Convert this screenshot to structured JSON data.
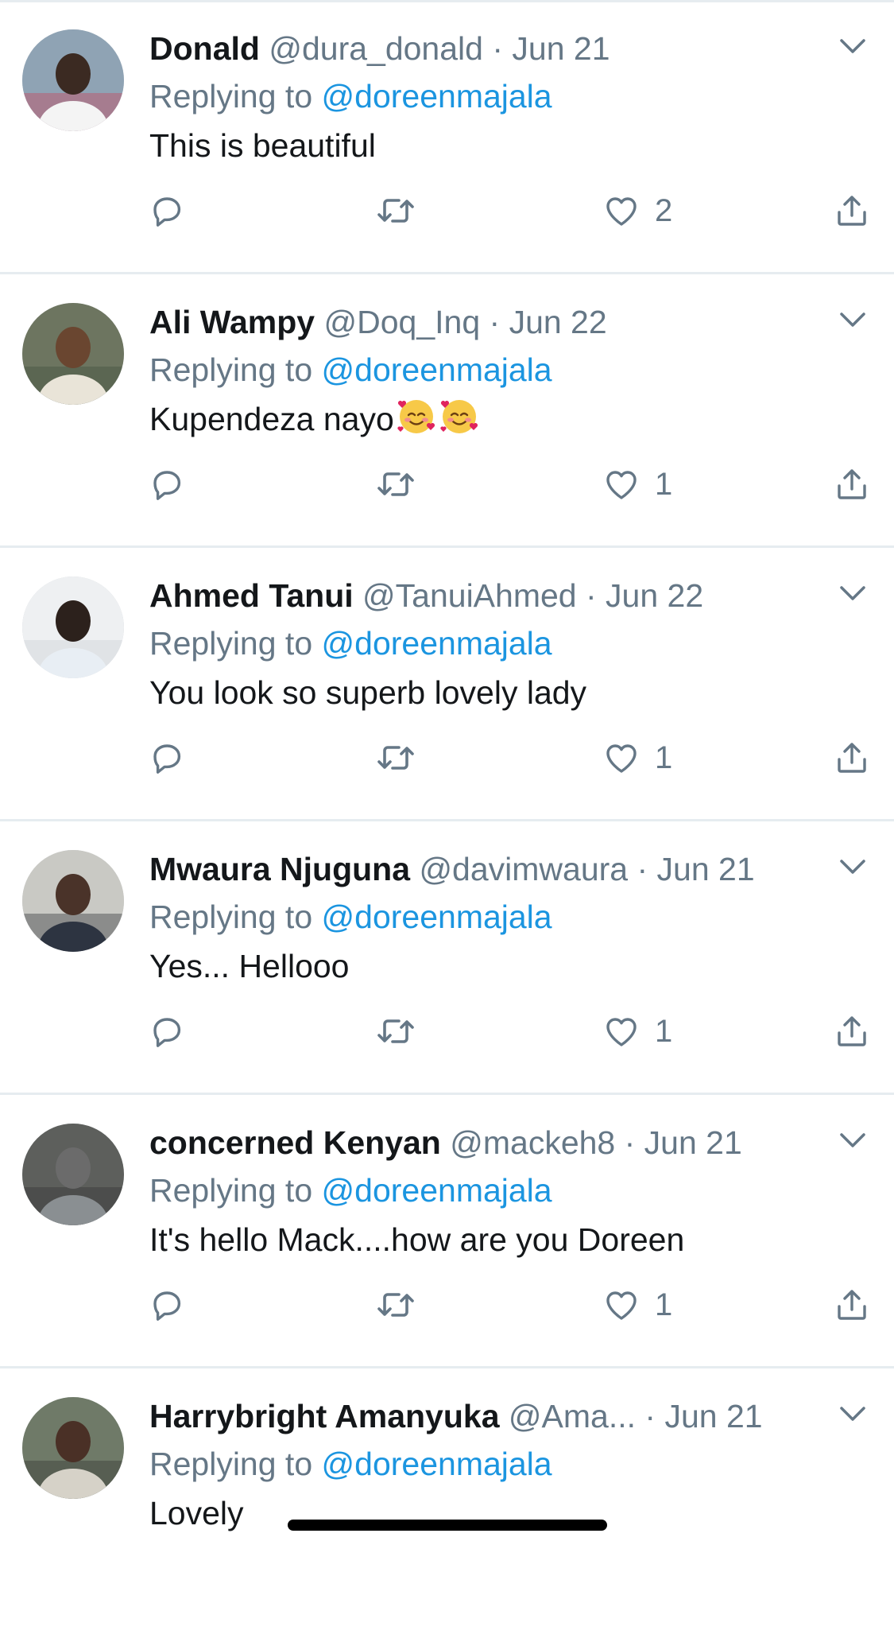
{
  "colors": {
    "accent": "#1b95e0",
    "secondary_text": "#657786",
    "primary_text": "#14171a",
    "divider": "#e6ecf0"
  },
  "icons": {
    "reply": "speech-bubble-icon",
    "retweet": "retweet-icon",
    "like": "heart-icon",
    "share": "share-icon",
    "more": "chevron-down-icon"
  },
  "replying_to_prefix": "Replying to",
  "tweets": [
    {
      "name": "Donald",
      "handle": "@dura_donald",
      "date": "Jun 21",
      "replying_to": "@doreenmajala",
      "text": "This is beautiful",
      "likes": "2"
    },
    {
      "name": "Ali Wampy",
      "handle": "@Doq_Inq",
      "date": "Jun 22",
      "replying_to": "@doreenmajala",
      "text": "Kupendeza nayo",
      "likes": "1"
    },
    {
      "name": "Ahmed Tanui",
      "handle": "@TanuiAhmed",
      "date": "Jun 22",
      "replying_to": "@doreenmajala",
      "text": "You look so superb lovely lady",
      "likes": "1"
    },
    {
      "name": "Mwaura Njuguna",
      "handle": "@davimwaura",
      "date": "Jun 21",
      "replying_to": "@doreenmajala",
      "text": "Yes... Hellooo",
      "likes": "1"
    },
    {
      "name": "concerned Kenyan",
      "handle": "@mackeh8",
      "date": "Jun 21",
      "replying_to": "@doreenmajala",
      "text": "It's hello Mack....how are you Doreen",
      "likes": "1"
    },
    {
      "name": "Harrybright Amanyuka",
      "handle": "@Ama...",
      "date": "Jun 21",
      "replying_to": "@doreenmajala",
      "text": "Lovely",
      "likes": ""
    }
  ]
}
